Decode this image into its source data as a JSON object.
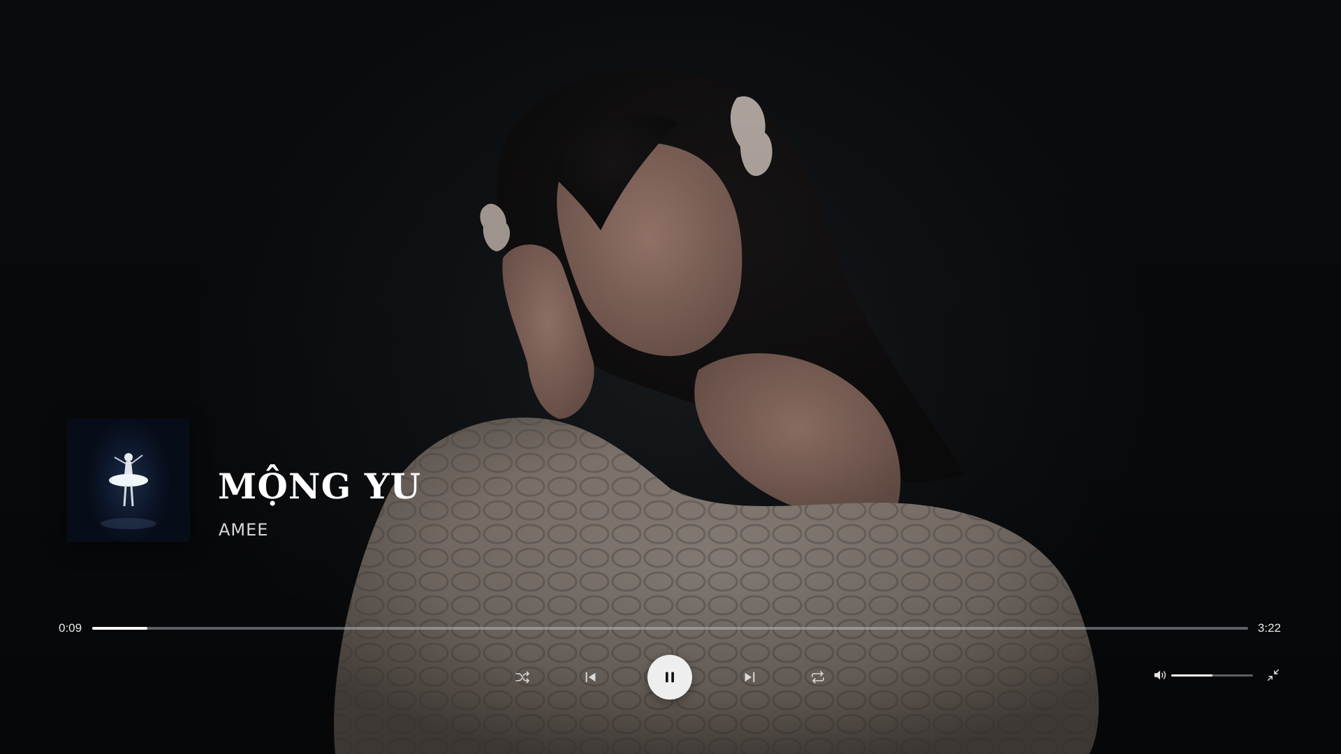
{
  "track": {
    "title": "MỘNG YU",
    "artist": "AMEE"
  },
  "progress": {
    "elapsed": "0:09",
    "total": "3:22",
    "fraction": 0.048
  },
  "controls": {
    "shuffle_icon": "shuffle-icon",
    "previous_icon": "skip-previous-icon",
    "play_pause_icon": "pause-icon",
    "next_icon": "skip-next-icon",
    "repeat_icon": "repeat-icon",
    "volume_icon": "volume-icon",
    "minimize_icon": "exit-fullscreen-icon"
  },
  "volume": {
    "fraction": 0.5
  },
  "colors": {
    "accent": "#ffffff",
    "play_button": "#eeeeee",
    "track_bg": "#7c8089"
  }
}
